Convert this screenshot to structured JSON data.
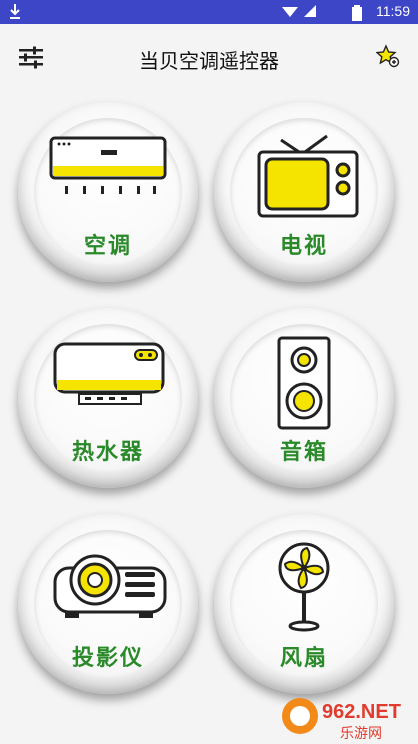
{
  "status": {
    "time": "11:59"
  },
  "app": {
    "title": "当贝空调遥控器"
  },
  "devices": [
    {
      "label": "空调"
    },
    {
      "label": "电视"
    },
    {
      "label": "热水器"
    },
    {
      "label": "音箱"
    },
    {
      "label": "投影仪"
    },
    {
      "label": "风扇"
    }
  ],
  "watermark": {
    "text": "962.NET",
    "sub": "乐游网"
  },
  "colors": {
    "status_bar": "#3d46c7",
    "accent_yellow": "#f4e400",
    "label_green": "#2a8a2a"
  },
  "icons": [
    "download-icon",
    "signal-icon",
    "battery-icon",
    "settings-sliders-icon",
    "star-icon"
  ]
}
